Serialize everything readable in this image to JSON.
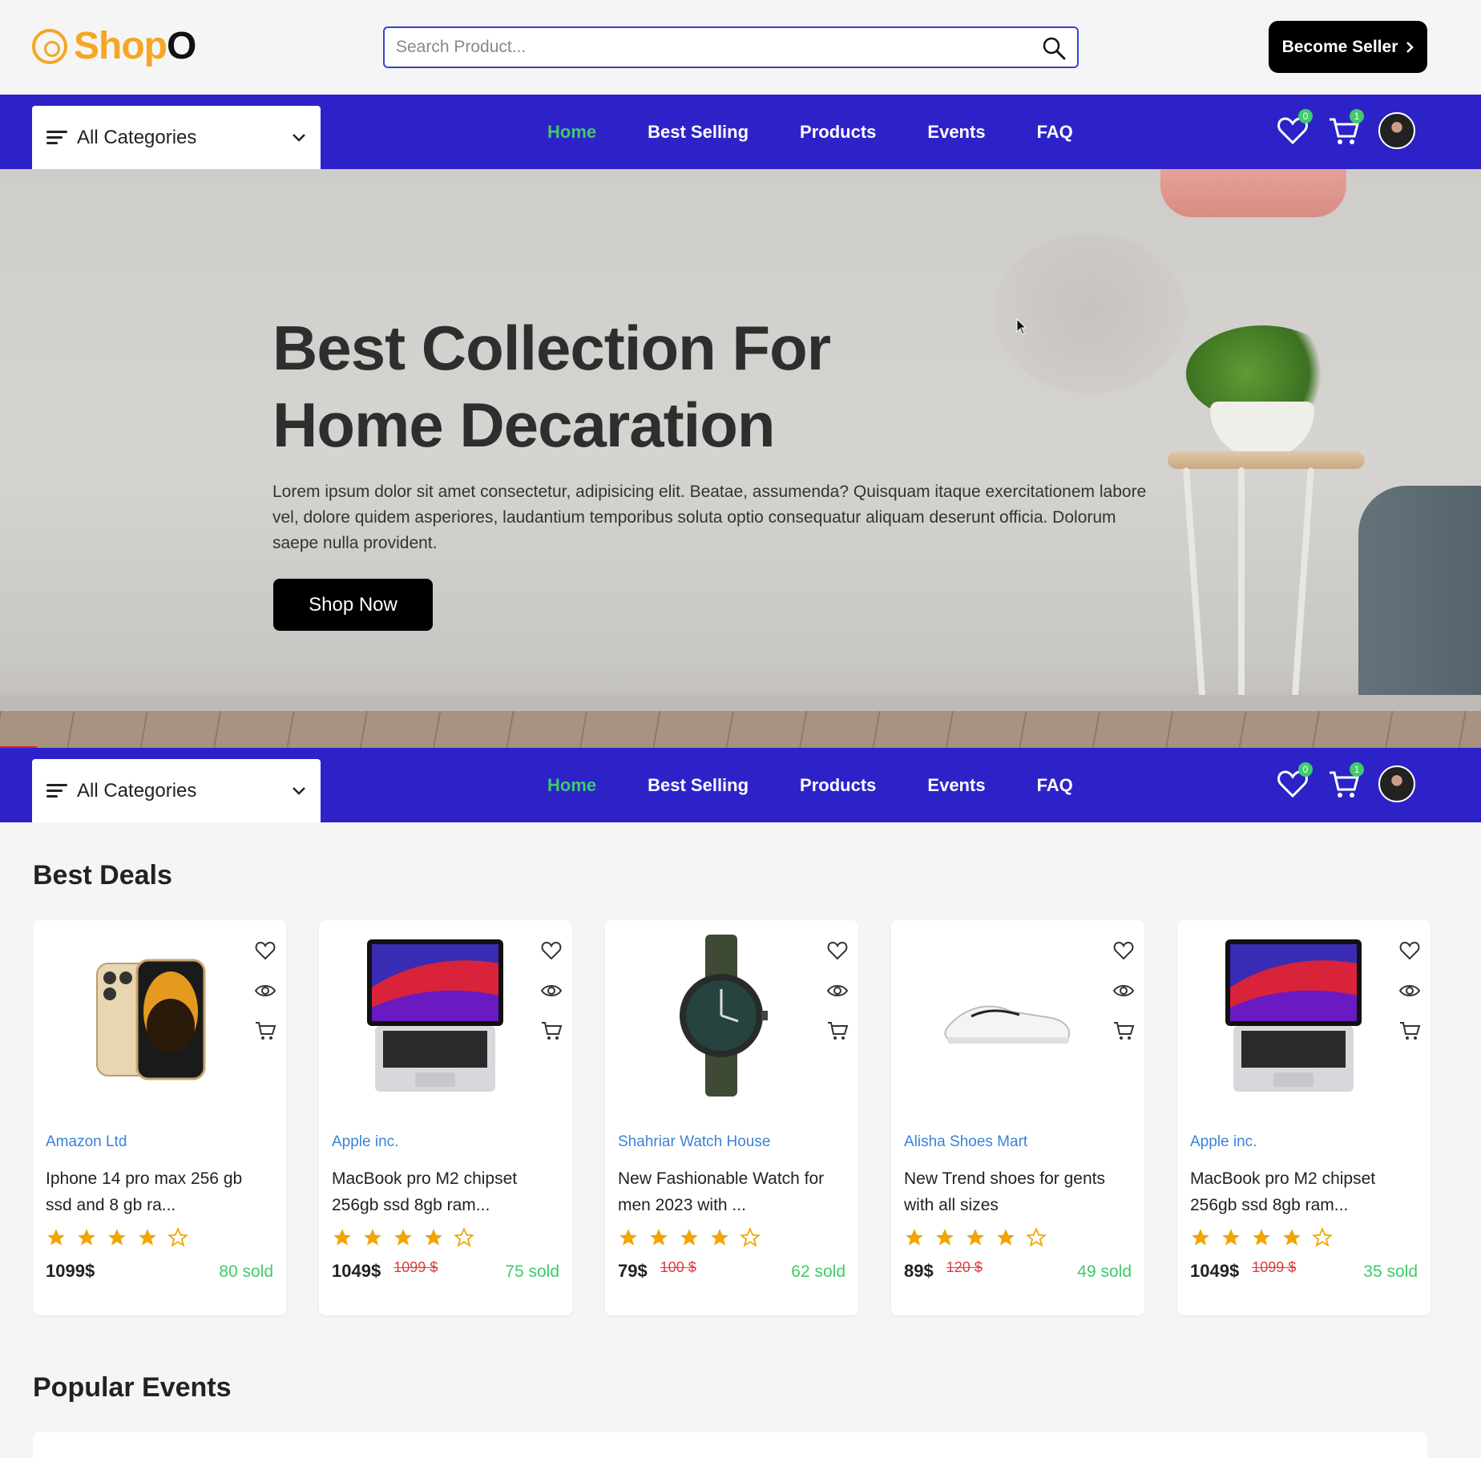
{
  "logo": {
    "text_main": "Shop",
    "text_end": "O"
  },
  "search": {
    "placeholder": "Search Product..."
  },
  "become_seller": {
    "label": "Become Seller"
  },
  "nav": {
    "categories_label": "All Categories",
    "links": [
      "Home",
      "Best Selling",
      "Products",
      "Events",
      "FAQ"
    ],
    "active": "Home",
    "wishlist_count": "0",
    "cart_count": "1"
  },
  "hero": {
    "title_line1": "Best Collection For",
    "title_line2": "Home Decaration",
    "text": "Lorem ipsum dolor sit amet consectetur, adipisicing elit. Beatae, assumenda? Quisquam itaque exercitationem labore vel, dolore quidem asperiores, laudantium temporibus soluta optio consequatur aliquam deserunt officia. Dolorum saepe nulla provident.",
    "button": "Shop Now"
  },
  "best_deals": {
    "title": "Best Deals",
    "products": [
      {
        "shop": "Amazon Ltd",
        "name": "Iphone 14 pro max 256 gb ssd and 8 gb ra...",
        "rating": 4,
        "price": "1099$",
        "old_price": "",
        "sold": "80 sold",
        "image": "phone"
      },
      {
        "shop": "Apple inc.",
        "name": "MacBook pro M2 chipset 256gb ssd 8gb ram...",
        "rating": 4,
        "price": "1049$",
        "old_price": "1099 $",
        "sold": "75 sold",
        "image": "laptop"
      },
      {
        "shop": "Shahriar Watch House",
        "name": "New Fashionable Watch for men 2023 with ...",
        "rating": 4,
        "price": "79$",
        "old_price": "100 $",
        "sold": "62 sold",
        "image": "watch"
      },
      {
        "shop": "Alisha Shoes Mart",
        "name": "New Trend shoes for gents with all sizes",
        "rating": 4,
        "price": "89$",
        "old_price": "120 $",
        "sold": "49 sold",
        "image": "shoe"
      },
      {
        "shop": "Apple inc.",
        "name": "MacBook pro M2 chipset 256gb ssd 8gb ram...",
        "rating": 4,
        "price": "1049$",
        "old_price": "1099 $",
        "sold": "35 sold",
        "image": "laptop"
      }
    ]
  },
  "popular_events": {
    "title": "Popular Events"
  },
  "colors": {
    "brand": "#f5a623",
    "nav": "#2d22c8",
    "active": "#3fca6b",
    "shop": "#3b82d6",
    "discount": "#e03a3a",
    "star": "#f0a500"
  },
  "icons": [
    "logo-icon",
    "search-icon",
    "chevron-right-icon",
    "menu-lines-icon",
    "chevron-down-icon",
    "heart-icon",
    "cart-icon",
    "eye-icon",
    "star-icon"
  ]
}
